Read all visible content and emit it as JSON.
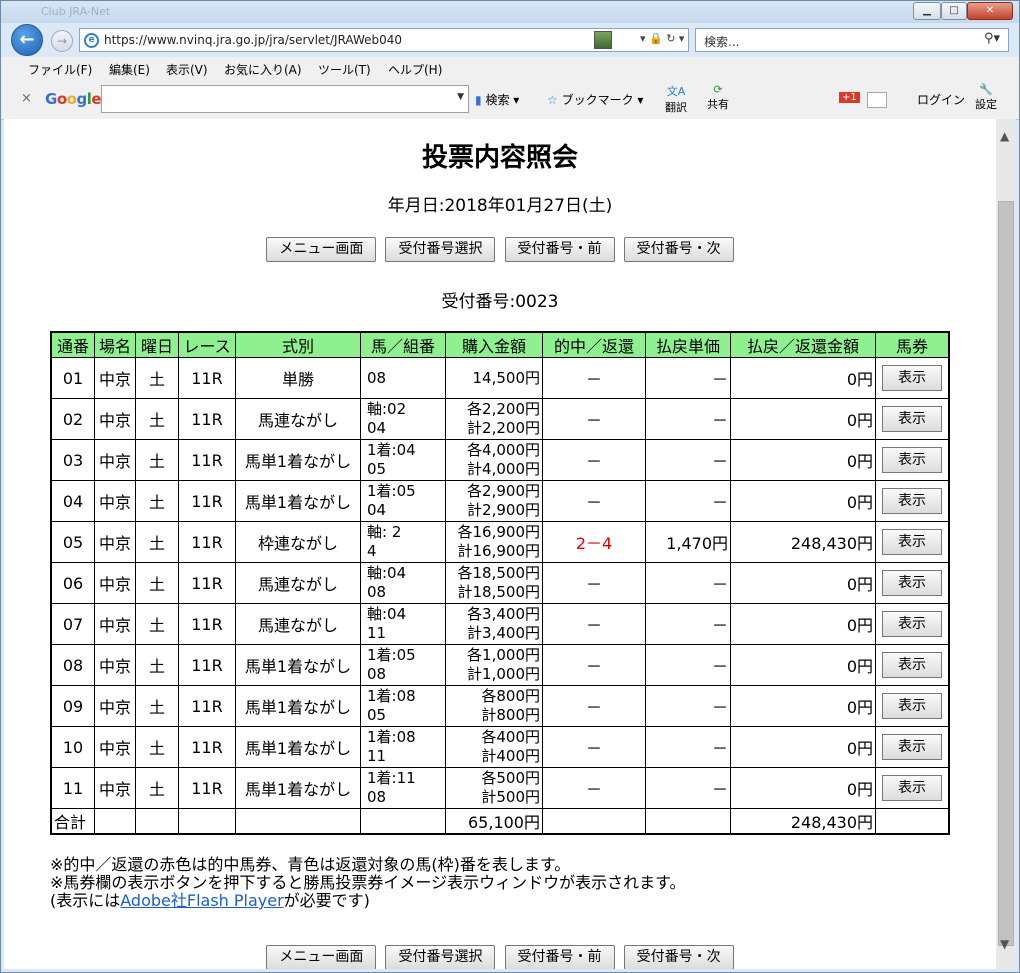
{
  "browser": {
    "title_ghost": "Club JRA-Net",
    "url": "https://www.nvinq.jra.go.jp/jra/servlet/JRAWeb040",
    "search_placeholder": "検索...",
    "menu": [
      "ファイル(F)",
      "編集(E)",
      "表示(V)",
      "お気に入り(A)",
      "ツール(T)",
      "ヘルプ(H)"
    ],
    "google": {
      "logo": "Google",
      "search_label": "検索",
      "bookmark_label": "ブックマーク",
      "translate_label": "翻訳",
      "share_label": "共有",
      "plus_label": "+1",
      "login_label": "ログイン",
      "settings_label": "設定"
    }
  },
  "page": {
    "title": "投票内容照会",
    "date_line": "年月日:2018年01月27日(土)",
    "buttons": {
      "menu": "メニュー画面",
      "select": "受付番号選択",
      "prev": "受付番号・前",
      "next": "受付番号・次"
    },
    "receipt_line": "受付番号:0023",
    "table": {
      "headers": [
        "通番",
        "場名",
        "曜日",
        "レース",
        "式別",
        "馬／組番",
        "購入金額",
        "的中／返還",
        "払戻単価",
        "払戻／返還金額",
        "馬券"
      ],
      "rows": [
        {
          "no": "01",
          "place": "中京",
          "day": "土",
          "race": "11R",
          "type": "単勝",
          "kumi1": "08",
          "kumi2": "",
          "amt1": "14,500円",
          "amt2": "",
          "hit": "－",
          "unit": "－",
          "payout": "0円",
          "btn": "表示"
        },
        {
          "no": "02",
          "place": "中京",
          "day": "土",
          "race": "11R",
          "type": "馬連ながし",
          "kumi1": "軸:02",
          "kumi2": "04",
          "amt1": "各2,200円",
          "amt2": "計2,200円",
          "hit": "－",
          "unit": "－",
          "payout": "0円",
          "btn": "表示"
        },
        {
          "no": "03",
          "place": "中京",
          "day": "土",
          "race": "11R",
          "type": "馬単1着ながし",
          "kumi1": "1着:04",
          "kumi2": "05",
          "amt1": "各4,000円",
          "amt2": "計4,000円",
          "hit": "－",
          "unit": "－",
          "payout": "0円",
          "btn": "表示"
        },
        {
          "no": "04",
          "place": "中京",
          "day": "土",
          "race": "11R",
          "type": "馬単1着ながし",
          "kumi1": "1着:05",
          "kumi2": "04",
          "amt1": "各2,900円",
          "amt2": "計2,900円",
          "hit": "－",
          "unit": "－",
          "payout": "0円",
          "btn": "表示"
        },
        {
          "no": "05",
          "place": "中京",
          "day": "土",
          "race": "11R",
          "type": "枠連ながし",
          "kumi1": "軸: 2",
          "kumi2": "4",
          "amt1": "各16,900円",
          "amt2": "計16,900円",
          "hit": "2－4",
          "unit": "1,470円",
          "payout": "248,430円",
          "btn": "表示"
        },
        {
          "no": "06",
          "place": "中京",
          "day": "土",
          "race": "11R",
          "type": "馬連ながし",
          "kumi1": "軸:04",
          "kumi2": "08",
          "amt1": "各18,500円",
          "amt2": "計18,500円",
          "hit": "－",
          "unit": "－",
          "payout": "0円",
          "btn": "表示"
        },
        {
          "no": "07",
          "place": "中京",
          "day": "土",
          "race": "11R",
          "type": "馬連ながし",
          "kumi1": "軸:04",
          "kumi2": "11",
          "amt1": "各3,400円",
          "amt2": "計3,400円",
          "hit": "－",
          "unit": "－",
          "payout": "0円",
          "btn": "表示"
        },
        {
          "no": "08",
          "place": "中京",
          "day": "土",
          "race": "11R",
          "type": "馬単1着ながし",
          "kumi1": "1着:05",
          "kumi2": "08",
          "amt1": "各1,000円",
          "amt2": "計1,000円",
          "hit": "－",
          "unit": "－",
          "payout": "0円",
          "btn": "表示"
        },
        {
          "no": "09",
          "place": "中京",
          "day": "土",
          "race": "11R",
          "type": "馬単1着ながし",
          "kumi1": "1着:08",
          "kumi2": "05",
          "amt1": "各800円",
          "amt2": "計800円",
          "hit": "－",
          "unit": "－",
          "payout": "0円",
          "btn": "表示"
        },
        {
          "no": "10",
          "place": "中京",
          "day": "土",
          "race": "11R",
          "type": "馬単1着ながし",
          "kumi1": "1着:08",
          "kumi2": "11",
          "amt1": "各400円",
          "amt2": "計400円",
          "hit": "－",
          "unit": "－",
          "payout": "0円",
          "btn": "表示"
        },
        {
          "no": "11",
          "place": "中京",
          "day": "土",
          "race": "11R",
          "type": "馬単1着ながし",
          "kumi1": "1着:11",
          "kumi2": "08",
          "amt1": "各500円",
          "amt2": "計500円",
          "hit": "－",
          "unit": "－",
          "payout": "0円",
          "btn": "表示"
        }
      ],
      "total": {
        "label": "合計",
        "amount": "65,100円",
        "payout": "248,430円"
      }
    },
    "notes": {
      "line1": "※的中／返還の赤色は的中馬券、青色は返還対象の馬(枠)番を表します。",
      "line2": "※馬券欄の表示ボタンを押下すると勝馬投票券イメージ表示ウィンドウが表示されます。",
      "line3_pre": "(表示には",
      "line3_link": "Adobe社Flash Player",
      "line3_post": "が必要です)"
    }
  },
  "colors": {
    "header_bg": "#8ef08e",
    "hit_red": "#e00000",
    "link": "#1a5fd0"
  }
}
